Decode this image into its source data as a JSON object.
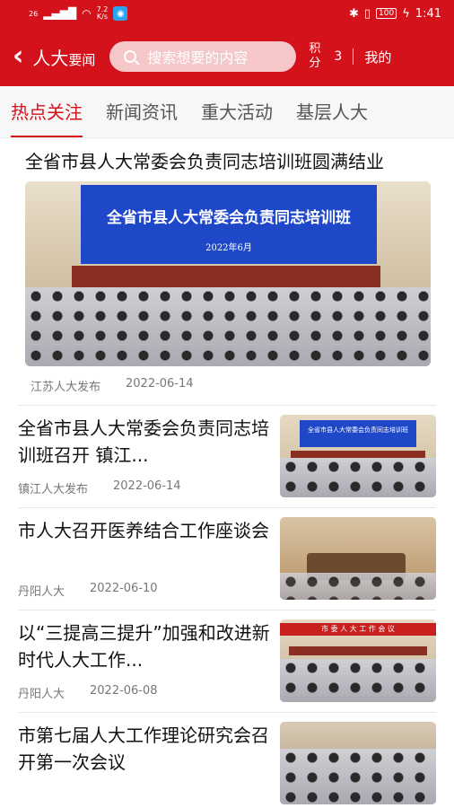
{
  "status": {
    "network": "26",
    "speed": "7.2\nK/s",
    "battery": "100",
    "time": "1:41"
  },
  "header": {
    "back_icon": "chevron-left-icon",
    "title_main": "人大",
    "title_sub": "要闻",
    "search_placeholder": "搜索想要的内容",
    "score_label": "积分",
    "score_value": "3",
    "mine_label": "我的"
  },
  "tabs": [
    {
      "label": "热点关注",
      "active": true
    },
    {
      "label": "新闻资讯",
      "active": false
    },
    {
      "label": "重大活动",
      "active": false
    },
    {
      "label": "基层人大",
      "active": false
    }
  ],
  "featured": {
    "title": "全省市县人大常委会负责同志培训班圆满结业",
    "image_banner_title": "全省市县人大常委会负责同志培训班",
    "image_banner_date": "2022年6月",
    "source": "江苏人大发布",
    "date": "2022-06-14"
  },
  "articles": [
    {
      "title": "全省市县人大常委会负责同志培训班召开 镇江...",
      "source": "镇江人大发布",
      "date": "2022-06-14",
      "thumb_banner": "全省市县人大常委会负责同志培训班"
    },
    {
      "title": "市人大召开医养结合工作座谈会",
      "source": "丹阳人大",
      "date": "2022-06-10",
      "thumb_banner": ""
    },
    {
      "title": "以“三提高三提升”加强和改进新时代人大工作...",
      "source": "丹阳人大",
      "date": "2022-06-08",
      "thumb_banner": "市 委 人 大 工 作 会 议"
    },
    {
      "title": "市第七届人大工作理论研究会召开第一次会议",
      "source": "",
      "date": "",
      "thumb_banner": ""
    }
  ],
  "colors": {
    "brand_red": "#d3121b",
    "banner_blue": "#1f48c9"
  }
}
